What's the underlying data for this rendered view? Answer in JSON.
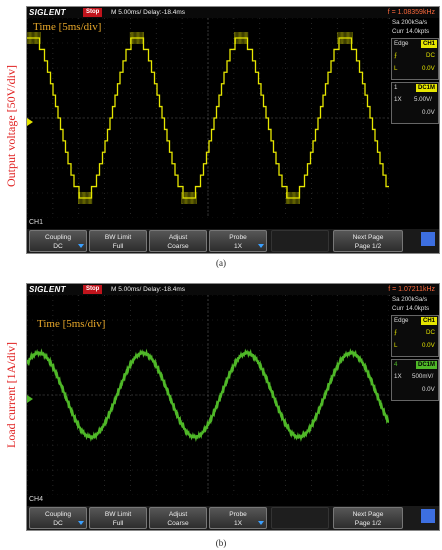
{
  "panels": [
    {
      "id": "a",
      "brand": "SIGLENT",
      "status": "Stop",
      "timebase": "M 5.00ms/ Delay:-18.4ms",
      "frequency": "f = 1.08359kHz",
      "sample_rate": "Sa 200kSa/s",
      "memory": "Curr 14.0kpts",
      "trigger_mode": "Edge",
      "trigger_source": "CH1",
      "slope_symbol": "⨍",
      "coupling_short": "DC",
      "level_label": "L",
      "level_value": "0.0V",
      "channel_number": "1",
      "channel_coupling_tag": "DC1M",
      "probe": "1X",
      "volts_div": "5.00V/",
      "offset": "0.0V",
      "channel_name": "CH1",
      "time_overlay": "Time [5ms/div]",
      "y_axis_label": "Output voltage [50V/div]",
      "caption": "(a)",
      "trace_color": "#e6e600",
      "softkeys": [
        {
          "top": "Coupling",
          "bottom": "DC"
        },
        {
          "top": "BW Limit",
          "bottom": "Full"
        },
        {
          "top": "Adjust",
          "bottom": "Coarse"
        },
        {
          "top": "Probe",
          "bottom": "1X"
        },
        {
          "top": "",
          "bottom": ""
        },
        {
          "top": "Next Page",
          "bottom": "Page 1/2"
        }
      ]
    },
    {
      "id": "b",
      "brand": "SIGLENT",
      "status": "Stop",
      "timebase": "M 5.00ms/ Delay:-18.4ms",
      "frequency": "f = 1.07211kHz",
      "sample_rate": "Sa 200kSa/s",
      "memory": "Curr 14.0kpts",
      "trigger_mode": "Edge",
      "trigger_source": "CH1",
      "slope_symbol": "⨍",
      "coupling_short": "DC",
      "level_label": "L",
      "level_value": "0.0V",
      "channel_number": "4",
      "channel_coupling_tag": "DC1M",
      "probe": "1X",
      "volts_div": "500mV/",
      "offset": "0.0V",
      "channel_name": "CH4",
      "time_overlay": "Time [5ms/div]",
      "y_axis_label": "Load current [1A/div]",
      "caption": "(b)",
      "trace_color": "#4fb828",
      "softkeys": [
        {
          "top": "Coupling",
          "bottom": "DC"
        },
        {
          "top": "BW Limit",
          "bottom": "Full"
        },
        {
          "top": "Adjust",
          "bottom": "Coarse"
        },
        {
          "top": "Probe",
          "bottom": "1X"
        },
        {
          "top": "",
          "bottom": ""
        },
        {
          "top": "Next Page",
          "bottom": "Page 1/2"
        }
      ]
    }
  ]
}
